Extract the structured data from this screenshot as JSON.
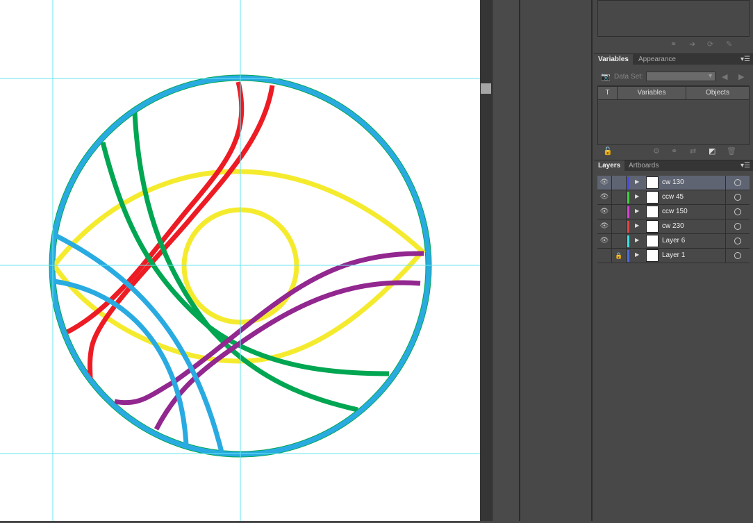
{
  "variables_panel": {
    "tabs": [
      {
        "label": "Variables",
        "active": true
      },
      {
        "label": "Appearance",
        "active": false
      }
    ],
    "data_set_label": "Data Set:",
    "data_set_value": "",
    "columns": [
      "T",
      "Variables",
      "Objects"
    ]
  },
  "layers_panel": {
    "tabs": [
      {
        "label": "Layers",
        "active": true
      },
      {
        "label": "Artboards",
        "active": false
      }
    ],
    "layers": [
      {
        "name": "cw 130",
        "visible": true,
        "locked": false,
        "color": "#4a4adb",
        "selected": true
      },
      {
        "name": "ccw 45",
        "visible": true,
        "locked": false,
        "color": "#3ed13e",
        "selected": false
      },
      {
        "name": "ccw 150",
        "visible": true,
        "locked": false,
        "color": "#d63fd6",
        "selected": false
      },
      {
        "name": "cw 230",
        "visible": true,
        "locked": false,
        "color": "#e04444",
        "selected": false
      },
      {
        "name": "Layer 6",
        "visible": true,
        "locked": false,
        "color": "#3ee0e0",
        "selected": false
      },
      {
        "name": "Layer 1",
        "visible": false,
        "locked": true,
        "color": "#4a6ae0",
        "selected": false
      }
    ]
  },
  "artwork_colors": {
    "blue": "#29abe2",
    "red": "#ed1c24",
    "green": "#00a651",
    "yellow": "#f5eb2e",
    "purple": "#92278f",
    "guide": "#66e6ee"
  }
}
